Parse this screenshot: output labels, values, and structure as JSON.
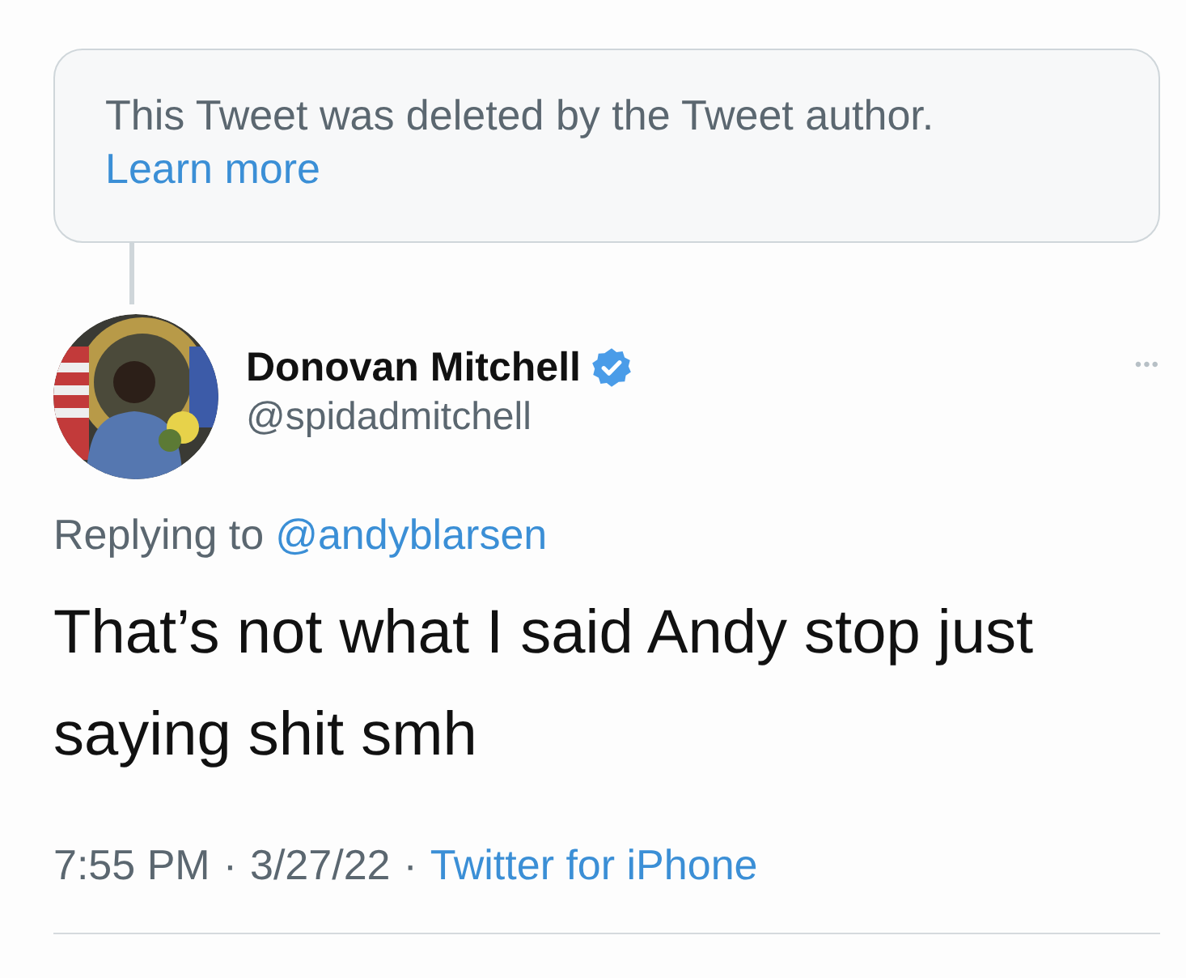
{
  "deleted_notice": {
    "text": "This Tweet was deleted by the Tweet author.",
    "link": "Learn more"
  },
  "tweet": {
    "author": {
      "name": "Donovan Mitchell",
      "verified": true,
      "handle": "@spidadmitchell"
    },
    "more": "•••",
    "reply": {
      "label": "Replying to",
      "target": "@andyblarsen"
    },
    "text": "That’s not what I said Andy stop just saying shit smh",
    "meta": [
      {
        "kind": "text",
        "text": "7:55 PM"
      },
      {
        "kind": "sep",
        "text": "·"
      },
      {
        "kind": "text",
        "text": "3/27/22"
      },
      {
        "kind": "sep",
        "text": "·"
      },
      {
        "kind": "link",
        "text": "Twitter for iPhone"
      }
    ]
  }
}
